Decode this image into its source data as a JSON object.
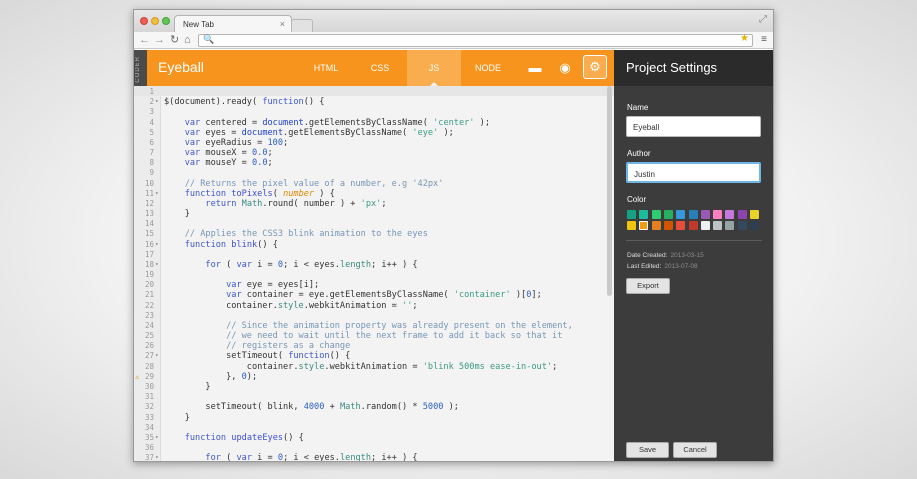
{
  "browser": {
    "tab_title": "New Tab",
    "tab_close": "×",
    "resize_icon": "⤢",
    "nav": {
      "back": "←",
      "forward": "→",
      "reload": "↻",
      "home": "⌂"
    },
    "search_icon": "🔍",
    "star_icon": "★",
    "menu_icon": "≡",
    "address": ""
  },
  "app": {
    "side_label": "CODER",
    "title": "Eyeball",
    "tabs": [
      {
        "label": "HTML"
      },
      {
        "label": "CSS"
      },
      {
        "label": "JS",
        "active": true
      },
      {
        "label": "NODE"
      }
    ],
    "folder_icon": "▬",
    "eye_icon": "◉",
    "gear_icon": "⚙",
    "accent_color": "#f7941d"
  },
  "editor": {
    "lines": [
      {
        "n": "1",
        "html": ""
      },
      {
        "n": "2",
        "fold": true,
        "html": "$(document).ready( <span class=\"k\">function</span>() {"
      },
      {
        "n": "3",
        "html": ""
      },
      {
        "n": "4",
        "html": "    <span class=\"k\">var</span> centered = <span class=\"v\">document</span>.getElementsByClassName( <span class=\"s\">'center'</span> );"
      },
      {
        "n": "5",
        "html": "    <span class=\"k\">var</span> eyes = <span class=\"v\">document</span>.getElementsByClassName( <span class=\"s\">'eye'</span> );"
      },
      {
        "n": "6",
        "html": "    <span class=\"k\">var</span> eyeRadius = <span class=\"n\">100</span>;"
      },
      {
        "n": "7",
        "html": "    <span class=\"k\">var</span> mouseX = <span class=\"n\">0.0</span>;"
      },
      {
        "n": "8",
        "html": "    <span class=\"k\">var</span> mouseY = <span class=\"n\">0.0</span>;"
      },
      {
        "n": "9",
        "html": ""
      },
      {
        "n": "10",
        "html": "    <span class=\"c\">// Returns the pixel value of a number, e.g '42px'</span>"
      },
      {
        "n": "11",
        "fold": true,
        "html": "    <span class=\"k\">function</span> <span class=\"f\">toPixels</span>( <span class=\"p\">number</span> ) {"
      },
      {
        "n": "12",
        "html": "        <span class=\"k\">return</span> <span class=\"t\">Math</span>.round( number ) + <span class=\"s\">'px'</span>;"
      },
      {
        "n": "13",
        "html": "    }"
      },
      {
        "n": "14",
        "html": ""
      },
      {
        "n": "15",
        "html": "    <span class=\"c\">// Applies the CSS3 blink animation to the eyes</span>"
      },
      {
        "n": "16",
        "fold": true,
        "html": "    <span class=\"k\">function</span> <span class=\"f\">blink</span>() {"
      },
      {
        "n": "17",
        "html": ""
      },
      {
        "n": "18",
        "fold": true,
        "html": "        <span class=\"k\">for</span> ( <span class=\"k\">var</span> i = <span class=\"n\">0</span>; i &lt; eyes.<span class=\"t\">length</span>; i++ ) {"
      },
      {
        "n": "19",
        "html": ""
      },
      {
        "n": "20",
        "html": "            <span class=\"k\">var</span> eye = eyes[i];"
      },
      {
        "n": "21",
        "html": "            <span class=\"k\">var</span> container = eye.getElementsByClassName( <span class=\"s\">'container'</span> )[<span class=\"n\">0</span>];"
      },
      {
        "n": "22",
        "html": "            container.<span class=\"t\">style</span>.webkitAnimation = <span class=\"s\">''</span>;"
      },
      {
        "n": "23",
        "html": ""
      },
      {
        "n": "24",
        "html": "            <span class=\"c\">// Since the animation property was already present on the element,</span>"
      },
      {
        "n": "25",
        "html": "            <span class=\"c\">// we need to wait until the next frame to add it back so that it</span>"
      },
      {
        "n": "26",
        "html": "            <span class=\"c\">// registers as a change</span>"
      },
      {
        "n": "27",
        "fold": true,
        "html": "            setTimeout( <span class=\"k\">function</span>() {"
      },
      {
        "n": "28",
        "html": "                container.<span class=\"t\">style</span>.webkitAnimation = <span class=\"s\">'blink 500ms ease-in-out'</span>;"
      },
      {
        "n": "29",
        "warn": true,
        "html": "            }, <span class=\"n\">0</span>);"
      },
      {
        "n": "30",
        "html": "        }"
      },
      {
        "n": "31",
        "html": ""
      },
      {
        "n": "32",
        "html": "        setTimeout( blink, <span class=\"n\">4000</span> + <span class=\"t\">Math</span>.random() * <span class=\"n\">5000</span> );"
      },
      {
        "n": "33",
        "html": "    }"
      },
      {
        "n": "34",
        "html": ""
      },
      {
        "n": "35",
        "fold": true,
        "html": "    <span class=\"k\">function</span> <span class=\"f\">updateEyes</span>() {"
      },
      {
        "n": "36",
        "html": ""
      },
      {
        "n": "37",
        "fold": true,
        "html": "        <span class=\"k\">for</span> ( <span class=\"k\">var</span> i = <span class=\"n\">0</span>; i &lt; eyes.<span class=\"t\">length</span>; i++ ) {"
      }
    ]
  },
  "settings": {
    "title": "Project Settings",
    "name_label": "Name",
    "name_value": "Eyeball",
    "author_label": "Author",
    "author_value": "Justin",
    "color_label": "Color",
    "colors": [
      "#16a085",
      "#1abc9c",
      "#2ecc71",
      "#27ae60",
      "#3498db",
      "#2980b9",
      "#9b59b6",
      "#ff80c0",
      "#c678dd",
      "#8e44ad",
      "#e9d42a",
      "#f1c40f",
      "#f39c12",
      "#e67e22",
      "#d35400",
      "#e74c3c",
      "#c0392b",
      "#ecf0f1",
      "#bdc3c7",
      "#95a5a6",
      "#34495e",
      "#2c3e50"
    ],
    "selected_color": 1,
    "created_label": "Date Created:",
    "created_value": "2013-03-15",
    "edited_label": "Last Edited:",
    "edited_value": "2013-07-08",
    "export_label": "Export",
    "save_label": "Save",
    "cancel_label": "Cancel"
  }
}
